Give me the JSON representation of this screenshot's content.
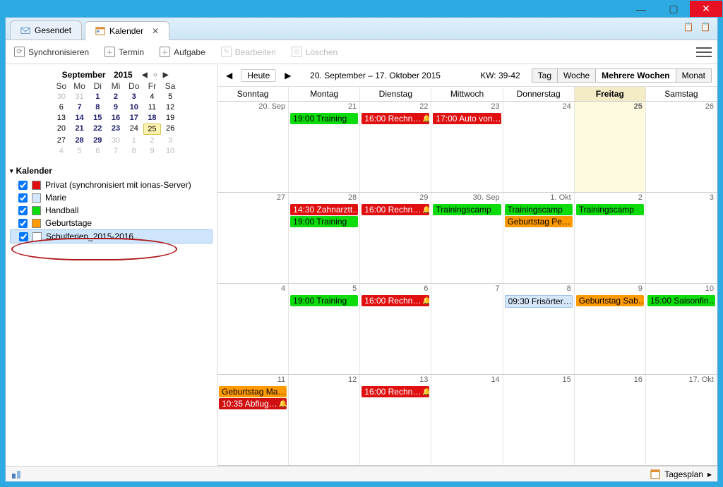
{
  "tabs": {
    "gesendet": "Gesendet",
    "kalender": "Kalender"
  },
  "toolbar": {
    "sync": "Synchronisieren",
    "termin": "Termin",
    "aufgabe": "Aufgabe",
    "bearbeiten": "Bearbeiten",
    "loeschen": "Löschen"
  },
  "miniCal": {
    "month": "September",
    "year": "2015",
    "dow": [
      "So",
      "Mo",
      "Di",
      "Mi",
      "Do",
      "Fr",
      "Sa"
    ],
    "cells": [
      {
        "n": "30",
        "g": 1
      },
      {
        "n": "31",
        "g": 1
      },
      {
        "n": "1",
        "b": 1
      },
      {
        "n": "2",
        "b": 1
      },
      {
        "n": "3",
        "b": 1
      },
      {
        "n": "4"
      },
      {
        "n": "5"
      },
      {
        "n": "6"
      },
      {
        "n": "7",
        "b": 1
      },
      {
        "n": "8",
        "b": 1
      },
      {
        "n": "9",
        "b": 1
      },
      {
        "n": "10",
        "b": 1
      },
      {
        "n": "11"
      },
      {
        "n": "12"
      },
      {
        "n": "13"
      },
      {
        "n": "14",
        "b": 1
      },
      {
        "n": "15",
        "b": 1
      },
      {
        "n": "16",
        "b": 1
      },
      {
        "n": "17",
        "b": 1
      },
      {
        "n": "18",
        "b": 1
      },
      {
        "n": "19"
      },
      {
        "n": "20"
      },
      {
        "n": "21",
        "b": 1
      },
      {
        "n": "22",
        "b": 1
      },
      {
        "n": "23",
        "b": 1
      },
      {
        "n": "24"
      },
      {
        "n": "25",
        "t": 1
      },
      {
        "n": "26"
      },
      {
        "n": "27"
      },
      {
        "n": "28",
        "b": 1
      },
      {
        "n": "29",
        "b": 1
      },
      {
        "n": "30",
        "g": 1
      },
      {
        "n": "1",
        "g": 1
      },
      {
        "n": "2",
        "g": 1
      },
      {
        "n": "3",
        "g": 1
      },
      {
        "n": "4",
        "g": 1
      },
      {
        "n": "5",
        "g": 1
      },
      {
        "n": "6",
        "g": 1
      },
      {
        "n": "7",
        "g": 1
      },
      {
        "n": "8",
        "g": 1
      },
      {
        "n": "9",
        "g": 1
      },
      {
        "n": "10",
        "g": 1
      }
    ]
  },
  "calListHeader": "Kalender",
  "calendars": [
    {
      "label": "Privat (synchronisiert mit ionas-Server)",
      "color": "#e01010",
      "checked": true
    },
    {
      "label": "Marie",
      "color": "#d5e7fb",
      "checked": true
    },
    {
      "label": "Handball",
      "color": "#0cdc0c",
      "checked": true
    },
    {
      "label": "Geburtstage",
      "color": "#ff9a00",
      "checked": true
    },
    {
      "label": "Schulferien_2015-2016",
      "color": "#ffffff",
      "checked": true,
      "selected": true
    }
  ],
  "calNav": {
    "heute": "Heute",
    "range": "20. September – 17. Oktober 2015",
    "kw": "KW: 39-42"
  },
  "views": {
    "tag": "Tag",
    "woche": "Woche",
    "mehrere": "Mehrere Wochen",
    "monat": "Monat"
  },
  "dow": [
    "Sonntag",
    "Montag",
    "Dienstag",
    "Mittwoch",
    "Donnerstag",
    "Freitag",
    "Samstag"
  ],
  "weeks": [
    [
      {
        "date": "20. Sep"
      },
      {
        "date": "21",
        "events": [
          {
            "cls": "ev-green",
            "text": "19:00 Training"
          }
        ]
      },
      {
        "date": "22",
        "events": [
          {
            "cls": "ev-red",
            "text": "16:00 Rechn…",
            "bell": 1
          }
        ]
      },
      {
        "date": "23",
        "events": [
          {
            "cls": "ev-red",
            "text": "17:00 Auto von…"
          }
        ]
      },
      {
        "date": "24"
      },
      {
        "date": "25",
        "today": 1
      },
      {
        "date": "26"
      }
    ],
    [
      {
        "date": "27"
      },
      {
        "date": "28",
        "events": [
          {
            "cls": "ev-red",
            "text": "14:30 Zahnarztt…"
          },
          {
            "cls": "ev-green",
            "text": "19:00 Training"
          }
        ]
      },
      {
        "date": "29",
        "events": [
          {
            "cls": "ev-red",
            "text": "16:00 Rechn…",
            "bell": 1
          }
        ]
      },
      {
        "date": "30. Sep",
        "events": [
          {
            "cls": "ev-green",
            "text": "Trainingscamp"
          }
        ]
      },
      {
        "date": "1. Okt",
        "events": [
          {
            "cls": "ev-green",
            "text": "Trainingscamp"
          },
          {
            "cls": "ev-orange",
            "text": "Geburtstag Pe…"
          }
        ]
      },
      {
        "date": "2",
        "events": [
          {
            "cls": "ev-green",
            "text": "Trainingscamp"
          }
        ]
      },
      {
        "date": "3"
      }
    ],
    [
      {
        "date": "4"
      },
      {
        "date": "5",
        "events": [
          {
            "cls": "ev-green",
            "text": "19:00 Training"
          }
        ]
      },
      {
        "date": "6",
        "events": [
          {
            "cls": "ev-red",
            "text": "16:00 Rechn…",
            "bell": 1
          }
        ]
      },
      {
        "date": "7"
      },
      {
        "date": "8",
        "events": [
          {
            "cls": "ev-blue",
            "text": "09:30 Frisörter…"
          }
        ]
      },
      {
        "date": "9",
        "events": [
          {
            "cls": "ev-orange",
            "text": "Geburtstag Sab…"
          }
        ]
      },
      {
        "date": "10",
        "events": [
          {
            "cls": "ev-green",
            "text": "15:00 Saisonfin…"
          }
        ]
      }
    ],
    [
      {
        "date": "11",
        "events": [
          {
            "cls": "ev-orange",
            "text": "Geburtstag Ma…"
          },
          {
            "cls": "ev-red2",
            "text": "10:35 Abflug…",
            "bell": 1
          }
        ]
      },
      {
        "date": "12"
      },
      {
        "date": "13",
        "events": [
          {
            "cls": "ev-red",
            "text": "16:00 Rechn…",
            "bell": 1
          }
        ]
      },
      {
        "date": "14"
      },
      {
        "date": "15"
      },
      {
        "date": "16"
      },
      {
        "date": "17. Okt"
      }
    ]
  ],
  "status": {
    "tagesplan": "Tagesplan"
  }
}
